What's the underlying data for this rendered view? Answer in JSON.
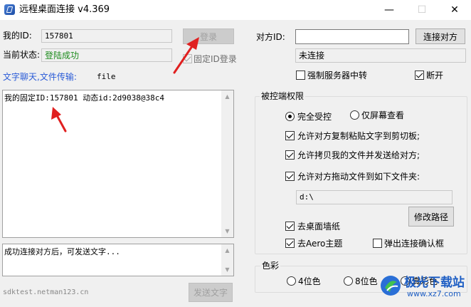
{
  "window": {
    "title": "远程桌面连接 v4.369",
    "minimize_glyph": "—",
    "maximize_glyph": "☐",
    "close_glyph": "✕"
  },
  "left": {
    "my_id_label": "我的ID:",
    "my_id_value": "157801",
    "login_button": "登录",
    "status_label": "当前状态:",
    "status_value": "登陆成功",
    "fixed_id_login_label": "固定ID登录",
    "fixed_id_login_checked": true,
    "chat_link": "文字聊天,文件传输:",
    "file_text": "file",
    "log_text": "我的固定ID:157801 动态id:2d9038@38c4",
    "message_text": "成功连接对方后，可发送文字...",
    "send_button": "发送文字",
    "footer_site": "sdktest.netman123.cn"
  },
  "right": {
    "peer_id_label": "对方ID:",
    "peer_id_value": "",
    "connect_button": "连接对方",
    "conn_status": "未连接",
    "force_relay_label": "强制服务器中转",
    "force_relay_checked": false,
    "disconnect_label": "断开",
    "disconnect_checked": true,
    "permissions": {
      "title": "被控端权限",
      "full_control": "完全受控",
      "view_only": "仅屏幕查看",
      "mode_selected": "full_control",
      "allow_clipboard": "允许对方复制粘贴文字到剪切板;",
      "allow_copy_files": "允许拷贝我的文件并发送给对方;",
      "allow_drag_files": "允许对方拖动文件到如下文件夹:",
      "folder_path": "d:\\",
      "change_path_button": "修改路径",
      "remove_wallpaper": "去桌面墙纸",
      "remove_aero": "去Aero主题",
      "popup_confirm": "弹出连接确认框",
      "popup_confirm_checked": false
    },
    "color": {
      "title": "色彩",
      "opt4": "4位色",
      "opt8": "8位色",
      "opt_true": "真彩色",
      "selected": "none"
    }
  },
  "watermark": {
    "brand": "极光下载站",
    "url": "www.xz7.com"
  },
  "colors": {
    "link_blue": "#2a5bd7",
    "status_green": "#1e8c1e",
    "annotation_red": "#e02020"
  }
}
